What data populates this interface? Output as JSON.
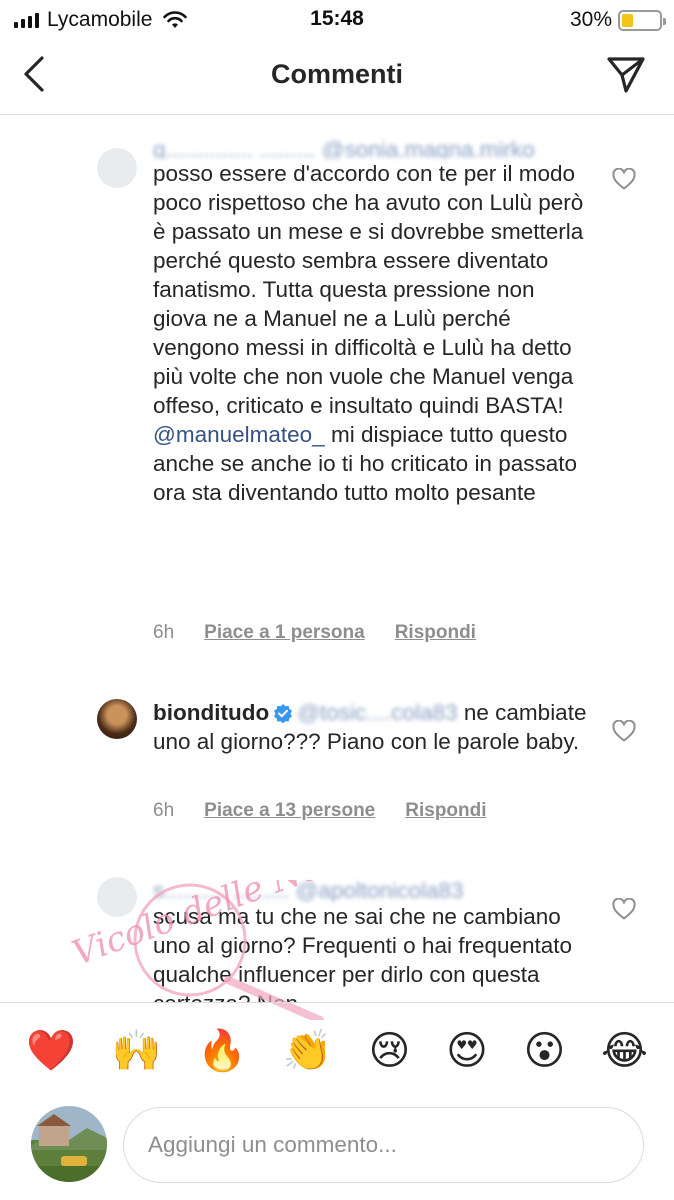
{
  "status": {
    "carrier": "Lycamobile",
    "time": "15:48",
    "battery": "30%",
    "battery_level": 0.3
  },
  "nav": {
    "title": "Commenti"
  },
  "comments": [
    {
      "username_blurred": "g.............. ......... @sonia.magna.mirko",
      "text": "posso essere d'accordo con te per il modo poco rispettoso che ha avuto con Lulù però è passato un mese e si dovrebbe smetterla perché questo sembra essere diventato fanatismo. Tutta questa pressione non giova ne a Manuel ne a Lulù perché vengono messi in difficoltà e Lulù ha detto più volte che non vuole che Manuel venga offeso, criticato e insultato quindi BASTA!",
      "mention": "@manuelmateo_",
      "text2": "mi dispiace tutto questo anche se anche io ti ho criticato in passato ora sta diventando tutto molto pesante",
      "time": "6h",
      "likes": "Piace a 1 persona",
      "reply": "Rispondi"
    },
    {
      "username": "bionditudo",
      "mention_blurred": "@tosic....cola83",
      "text": "ne cambiate uno al giorno??? Piano con le parole baby.",
      "time": "6h",
      "likes": "Piace a 13 persone",
      "reply": "Rispondi"
    },
    {
      "username_blurred": "s.......... ......... @apoltonicola83",
      "text": "scusa ma tu che ne sai che ne cambiano uno al giorno? Frequenti o hai frequentato qualche influencer per dirlo con questa certezza? Non"
    }
  ],
  "watermark": {
    "text": "Vicolo delle News"
  },
  "emojis": [
    "❤️",
    "🙌",
    "🔥",
    "👏",
    "😢",
    "😍",
    "😮",
    "😂"
  ],
  "input": {
    "placeholder": "Aggiungi un commento..."
  },
  "colors": {
    "mention": "#385185",
    "secondary_text": "#8e8e8e",
    "battery": "#f2c518"
  }
}
